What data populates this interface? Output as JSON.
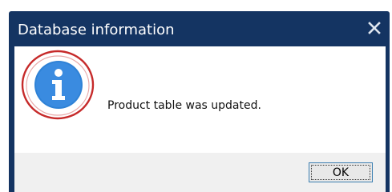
{
  "window": {
    "title": "Database information",
    "close_icon": "close-icon"
  },
  "content": {
    "icon": "info-icon",
    "message": "Product table was updated."
  },
  "footer": {
    "ok_label": "OK"
  },
  "colors": {
    "titlebar": "#143462",
    "info_blue": "#2f82d6",
    "highlight_red": "#c62a2a",
    "footer_bg": "#f0f0f0"
  }
}
